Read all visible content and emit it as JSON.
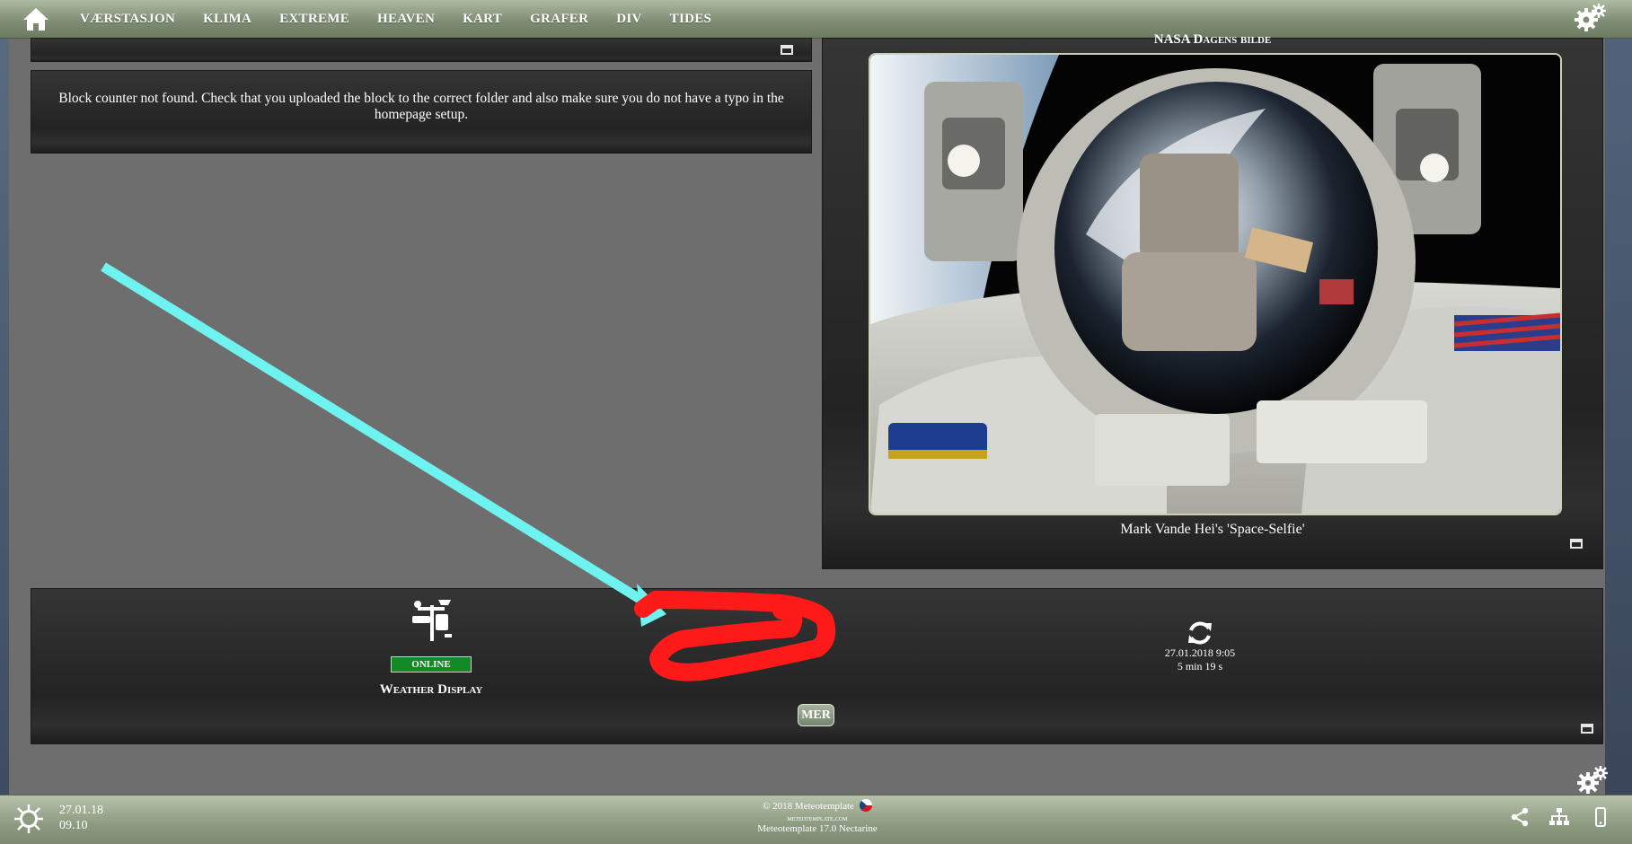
{
  "nav": {
    "items": [
      "VÆRSTASJON",
      "KLIMA",
      "EXTREME",
      "HEAVEN",
      "KART",
      "GRAFER",
      "DIV",
      "TIDES"
    ]
  },
  "block_error": {
    "message": "Block counter not found. Check that you uploaded the block to the correct folder and also make sure you do not have a typo in the homepage setup."
  },
  "nasa": {
    "title": "NASA Dagens bilde",
    "caption": "Mark Vande Hei's 'Space-Selfie'"
  },
  "station": {
    "status": "ONLINE",
    "software": "Weather Display",
    "updated_datetime": "27.01.2018 9:05",
    "updated_ago": "5 min 19 s",
    "more_label": "MER"
  },
  "footer": {
    "date": "27.01.18",
    "time": "09.10",
    "copyright": "© 2018  Meteotemplate",
    "site": "meteotemplate.com",
    "version": "Meteotemplate 17.0 Nectarine"
  },
  "colors": {
    "nav_bar": "#8a9a7e",
    "panel_bg": "#2a2a2a",
    "page_bg": "#6e6e6e",
    "online_badge": "#138a25",
    "annotation_arrow": "#6ff3f0",
    "annotation_scribble": "#ff1a1a"
  },
  "icons": {
    "home": "home-icon",
    "settings": "gears-icon",
    "station": "weather-station-icon",
    "refresh": "refresh-icon",
    "share": "share-icon",
    "sitemap": "sitemap-icon",
    "mobile": "mobile-icon"
  }
}
